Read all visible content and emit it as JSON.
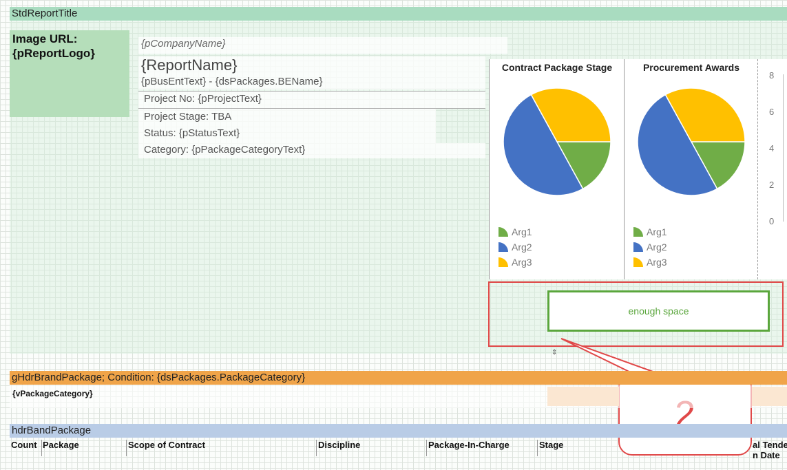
{
  "bands": {
    "title": "StdReportTitle",
    "group": "gHdrBrandPackage; Condition: {dsPackages.PackageCategory}",
    "group_field": "{vPackageCategory}",
    "header": "hdrBandPackage"
  },
  "logo": {
    "line1": "Image URL:",
    "line2": "{pReportLogo}"
  },
  "fields": {
    "company": "{pCompanyName}",
    "report_name": "{ReportName}",
    "bus_ent": "{pBusEntText} - {dsPackages.BEName}",
    "project_no": "Project No: {pProjectText}",
    "project_stage": "Project Stage: TBA",
    "status": "Status: {pStatusText}",
    "category": "Category: {pPackageCategoryText}"
  },
  "chart_data": [
    {
      "type": "pie",
      "title": "Contract Package Stage",
      "categories": [
        "Arg1",
        "Arg2",
        "Arg3"
      ],
      "values": [
        17,
        50,
        33
      ],
      "colors": [
        "#70ad47",
        "#4472c4",
        "#ffc000"
      ]
    },
    {
      "type": "pie",
      "title": "Procurement Awards",
      "categories": [
        "Arg1",
        "Arg2",
        "Arg3"
      ],
      "values": [
        17,
        50,
        33
      ],
      "colors": [
        "#70ad47",
        "#4472c4",
        "#ffc000"
      ]
    }
  ],
  "axis_ticks": [
    "8",
    "6",
    "4",
    "2",
    "0"
  ],
  "annotation": {
    "note": "enough space",
    "callout_number": "2"
  },
  "columns": [
    "Count",
    "Package",
    "Scope of Contract",
    "Discipline",
    "Package-In-Charge",
    "Stage",
    "al Tende",
    "n Date"
  ],
  "colors": {
    "accent_red": "#e04848",
    "accent_green": "#5aa63c"
  }
}
